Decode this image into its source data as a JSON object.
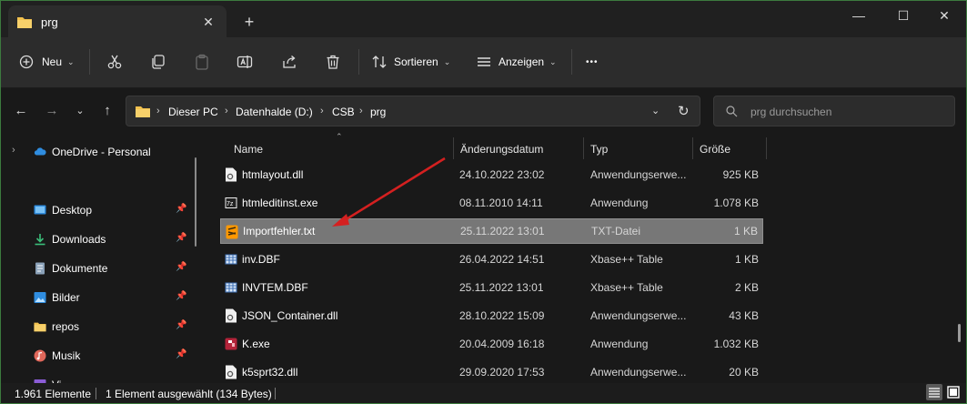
{
  "window": {
    "tab_title": "prg",
    "tab_close": "✕",
    "new_tab": "+",
    "minimize": "—",
    "maximize": "☐",
    "close": "✕"
  },
  "toolbar": {
    "new_label": "Neu",
    "sort_label": "Sortieren",
    "view_label": "Anzeigen",
    "more": "•••"
  },
  "address": {
    "crumbs": [
      "Dieser PC",
      "Datenhalde (D:)",
      "CSB",
      "prg"
    ]
  },
  "search": {
    "placeholder": "prg durchsuchen"
  },
  "sidebar": {
    "items": [
      {
        "label": "OneDrive - Personal",
        "icon": "cloud-icon"
      },
      {
        "label": "Desktop",
        "icon": "desktop-icon",
        "pinned": true
      },
      {
        "label": "Downloads",
        "icon": "download-icon",
        "pinned": true
      },
      {
        "label": "Dokumente",
        "icon": "document-icon",
        "pinned": true
      },
      {
        "label": "Bilder",
        "icon": "picture-icon",
        "pinned": true
      },
      {
        "label": "repos",
        "icon": "folder-icon",
        "pinned": true
      },
      {
        "label": "Musik",
        "icon": "music-icon",
        "pinned": true
      },
      {
        "label": "Vi",
        "icon": "video-icon"
      }
    ]
  },
  "columns": {
    "name": "Name",
    "date": "Änderungsdatum",
    "type": "Typ",
    "size": "Größe"
  },
  "files": [
    {
      "name": "htmlayout.dll",
      "date": "24.10.2022 23:02",
      "type": "Anwendungserwe...",
      "size": "925 KB",
      "icon": "dll-icon"
    },
    {
      "name": "htmleditinst.exe",
      "date": "08.11.2010 14:11",
      "type": "Anwendung",
      "size": "1.078 KB",
      "icon": "exe-icon"
    },
    {
      "name": "Importfehler.txt",
      "date": "25.11.2022 13:01",
      "type": "TXT-Datei",
      "size": "1 KB",
      "icon": "sublime-text-icon",
      "selected": true
    },
    {
      "name": "inv.DBF",
      "date": "26.04.2022 14:51",
      "type": "Xbase++ Table",
      "size": "1 KB",
      "icon": "table-icon"
    },
    {
      "name": "INVTEM.DBF",
      "date": "25.11.2022 13:01",
      "type": "Xbase++ Table",
      "size": "2 KB",
      "icon": "table-icon"
    },
    {
      "name": "JSON_Container.dll",
      "date": "28.10.2022 15:09",
      "type": "Anwendungserwe...",
      "size": "43 KB",
      "icon": "dll-icon"
    },
    {
      "name": "K.exe",
      "date": "20.04.2009 16:18",
      "type": "Anwendung",
      "size": "1.032 KB",
      "icon": "app-icon"
    },
    {
      "name": "k5sprt32.dll",
      "date": "29.09.2020 17:53",
      "type": "Anwendungserwe...",
      "size": "20 KB",
      "icon": "dll-icon"
    }
  ],
  "status": {
    "count": "1.961 Elemente",
    "selection": "1 Element ausgewählt (134 Bytes)"
  },
  "colors": {
    "selection": "#777777",
    "arrow": "#d42020",
    "folder": "#f2c14e",
    "accent": "#4aa3e8"
  }
}
